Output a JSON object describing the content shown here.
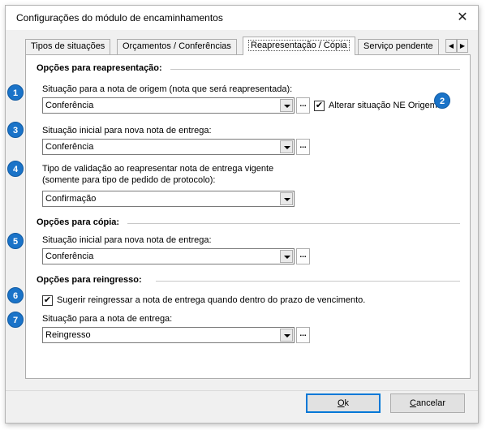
{
  "window": {
    "title": "Configurações do módulo de encaminhamentos",
    "close_glyph": "✕"
  },
  "tabs": [
    {
      "label": "Tipos de situações"
    },
    {
      "label": "Orçamentos / Conferências"
    },
    {
      "label": "Reapresentação / Cópia"
    },
    {
      "label": "Serviço pendente"
    }
  ],
  "active_tab": "Reapresentação / Cópia",
  "tab_scroll": {
    "left": "◀",
    "right": "▶"
  },
  "reapresentacao": {
    "header": "Opções para reapresentação:",
    "origem_label": "Situação para a nota de origem (nota que será reapresentada):",
    "origem_value": "Conferência",
    "alterar_checked": true,
    "alterar_label": "Alterar situação NE Origem",
    "inicial_label": "Situação inicial para nova nota de entrega:",
    "inicial_value": "Conferência",
    "validacao_label_1": "Tipo de validação ao reapresentar nota de entrega vigente",
    "validacao_label_2": "(somente para tipo de pedido de protocolo):",
    "validacao_value": "Confirmação"
  },
  "copia": {
    "header": "Opções para cópia:",
    "inicial_label": "Situação inicial para nova nota de entrega:",
    "inicial_value": "Conferência"
  },
  "reingresso": {
    "header": "Opções para reingresso:",
    "sugerir_checked": true,
    "sugerir_label": "Sugerir reingressar a nota de entrega quando dentro do prazo de vencimento.",
    "situacao_label": "Situação para a nota de entrega:",
    "situacao_value": "Reingresso"
  },
  "ellipsis_label": "...",
  "check_glyph": "✔",
  "badges": [
    "1",
    "2",
    "3",
    "4",
    "5",
    "6",
    "7"
  ],
  "buttons": {
    "ok": "Ok",
    "cancel": "Cancelar"
  },
  "colors": {
    "badge": "#1a73c8",
    "default_button_border": "#0078d7"
  }
}
